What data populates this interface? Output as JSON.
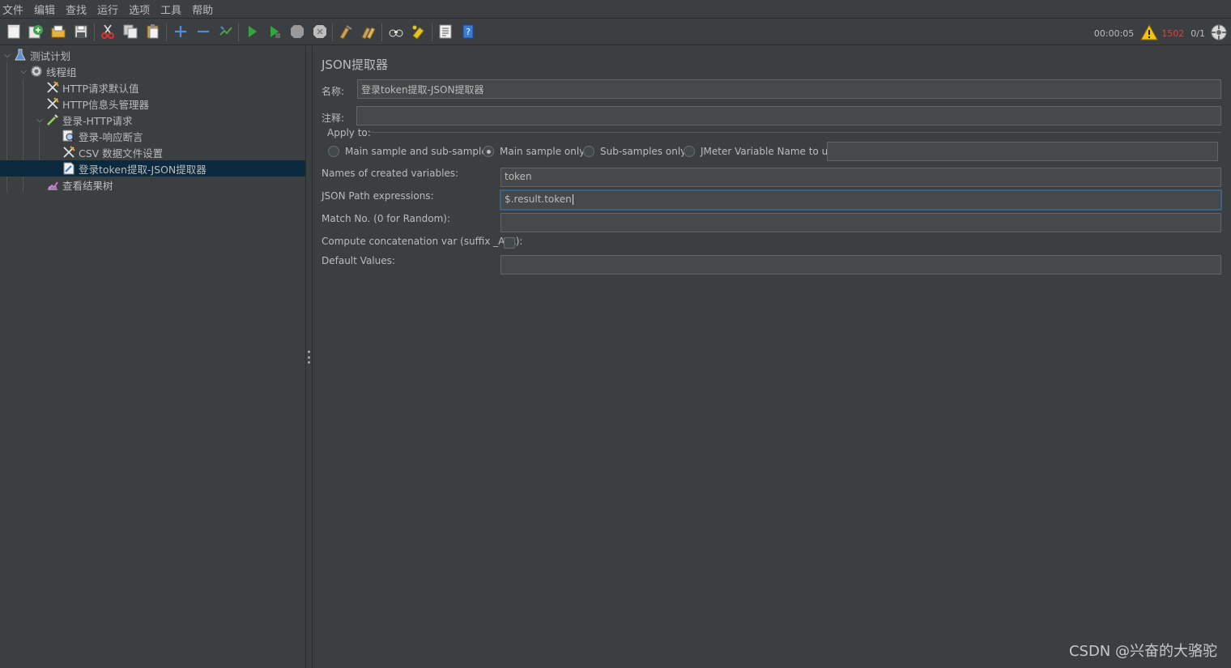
{
  "menu": [
    "文件",
    "编辑",
    "查找",
    "运行",
    "选项",
    "工具",
    "帮助"
  ],
  "toolbar": {
    "icons": [
      "new-icon",
      "templates-icon",
      "open-icon",
      "save-icon",
      "cut-icon",
      "copy-icon",
      "paste-icon",
      "expand-icon",
      "collapse-icon",
      "toggle-icon",
      "start-icon",
      "start-no-pause-icon",
      "stop-icon",
      "shutdown-icon",
      "clear-icon",
      "clear-all-icon",
      "search-icon",
      "reset-search-icon",
      "function-helper-icon",
      "help-icon"
    ]
  },
  "status": {
    "timer": "00:00:05",
    "warnings": "1502",
    "threads": "0/1"
  },
  "tree": [
    {
      "label": "测试计划",
      "icon": "flask-icon",
      "arrow": "⌄"
    },
    {
      "label": "线程组",
      "icon": "gear-icon",
      "arrow": "⌄"
    },
    {
      "label": "HTTP请求默认值",
      "icon": "wrench-icon",
      "arrow": ""
    },
    {
      "label": "HTTP信息头管理器",
      "icon": "wrench-icon",
      "arrow": ""
    },
    {
      "label": "登录-HTTP请求",
      "icon": "pipette-icon",
      "arrow": "⌄"
    },
    {
      "label": "登录-响应断言",
      "icon": "magnifier-icon",
      "arrow": ""
    },
    {
      "label": "CSV 数据文件设置",
      "icon": "wrench-icon",
      "arrow": ""
    },
    {
      "label": "登录token提取-JSON提取器",
      "icon": "document-icon",
      "arrow": ""
    },
    {
      "label": "查看结果树",
      "icon": "chart-icon",
      "arrow": ""
    }
  ],
  "panel": {
    "title": "JSON提取器",
    "name_label": "名称:",
    "name_value": "登录token提取-JSON提取器",
    "comment_label": "注释:",
    "comment_value": "",
    "apply_to": "Apply to:",
    "radios": [
      "Main sample and sub-samples",
      "Main sample only",
      "Sub-samples only",
      "JMeter Variable Name to use"
    ],
    "radio_selected": "Main sample only",
    "jmeter_var_value": "",
    "vars_label": "Names of created variables:",
    "vars_value": "token",
    "jsonpath_label": "JSON Path expressions:",
    "jsonpath_value": "$.result.token",
    "match_label": "Match No. (0 for Random):",
    "match_value": "",
    "concat_label": "Compute concatenation var (suffix _ALL):",
    "concat_checked": false,
    "default_label": "Default Values:",
    "default_value": ""
  },
  "watermark": "CSDN @兴奋的大骆驼"
}
